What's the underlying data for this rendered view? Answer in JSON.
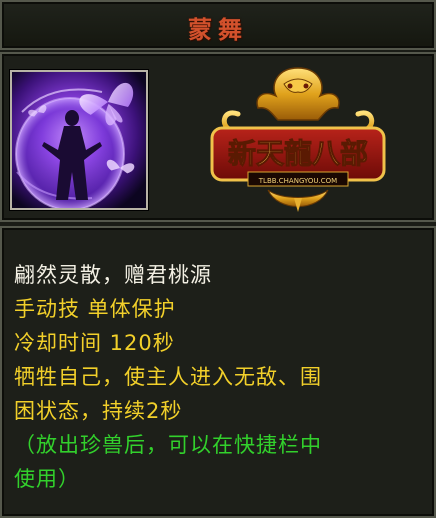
{
  "title": "蒙舞",
  "skill": {
    "icon": "butterfly-spirit-icon",
    "name_line": "翩然灵散，赠君桃源",
    "type_line": "手动技 单体保护",
    "cooldown_line": "冷却时间 120秒",
    "effect_line_1": "牺牲自己，使主人进入无敌、围",
    "effect_line_2": "困状态，持续2秒",
    "hint_line_1": "（放出珍兽后，可以在快捷栏中",
    "hint_line_2": "使用）"
  },
  "logo": {
    "text": "新天龍八部",
    "subtext": "TLBB.CHANGYOU.COM"
  },
  "colors": {
    "title": "#d2512c",
    "name": "#f3f0e4",
    "type": "#f2d02a",
    "cooldown": "#f2d02a",
    "effect": "#f2d02a",
    "hint": "#32d12c"
  }
}
